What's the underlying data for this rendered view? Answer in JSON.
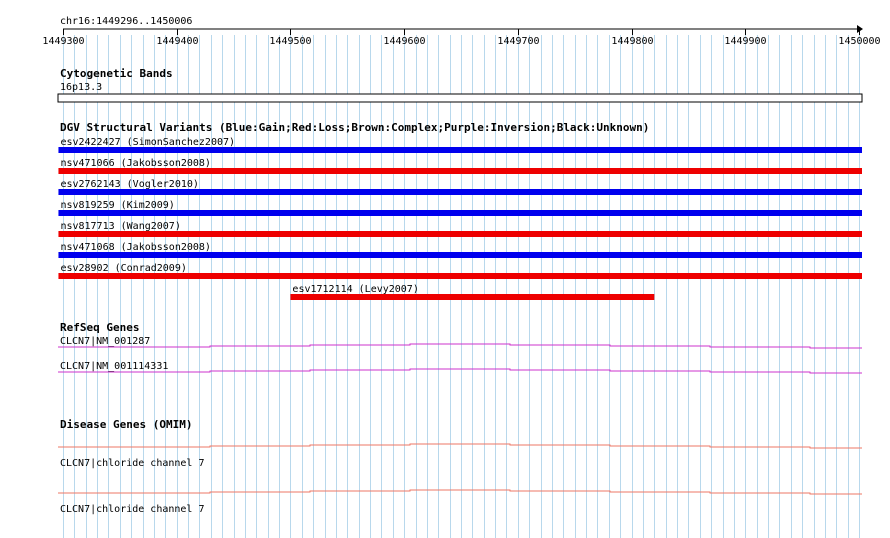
{
  "region_label": "chr16:1449296..1450006",
  "ruler": {
    "ticks": [
      "1449300",
      "1449400",
      "1449500",
      "1449600",
      "1449700",
      "1449800",
      "1449900",
      "1450000"
    ]
  },
  "tracks": {
    "cytoband": {
      "title": "Cytogenetic Bands",
      "band_label": "16p13.3"
    },
    "dgv": {
      "title": "DGV Structural Variants (Blue:Gain;Red:Loss;Brown:Complex;Purple:Inversion;Black:Unknown)",
      "colors": {
        "gain": "#0000ee",
        "loss": "#ee0000"
      },
      "features": [
        {
          "label": "esv2422427 (SimonSanchez2007)",
          "type": "gain",
          "start": 1449296,
          "end": 1450006
        },
        {
          "label": "nsv471066 (Jakobsson2008)",
          "type": "loss",
          "start": 1449296,
          "end": 1450006
        },
        {
          "label": "esv2762143 (Vogler2010)",
          "type": "gain",
          "start": 1449296,
          "end": 1450006
        },
        {
          "label": "nsv819259 (Kim2009)",
          "type": "gain",
          "start": 1449296,
          "end": 1450006
        },
        {
          "label": "nsv817713 (Wang2007)",
          "type": "loss",
          "start": 1449296,
          "end": 1450006
        },
        {
          "label": "nsv471068 (Jakobsson2008)",
          "type": "gain",
          "start": 1449296,
          "end": 1450006
        },
        {
          "label": "esv28902 (Conrad2009)",
          "type": "loss",
          "start": 1449296,
          "end": 1450006
        },
        {
          "label": "esv1712114 (Levy2007)",
          "type": "loss",
          "start": 1449500,
          "end": 1449820
        }
      ]
    },
    "refseq": {
      "title": "RefSeq Genes",
      "color": "#cc33cc",
      "genes": [
        {
          "label": "CLCN7|NM_001287"
        },
        {
          "label": "CLCN7|NM_001114331"
        }
      ]
    },
    "omim": {
      "title": "Disease Genes (OMIM)",
      "color": "#ee7766",
      "genes": [
        {
          "label": "CLCN7|chloride channel 7"
        },
        {
          "label": "CLCN7|chloride channel 7"
        }
      ]
    }
  }
}
